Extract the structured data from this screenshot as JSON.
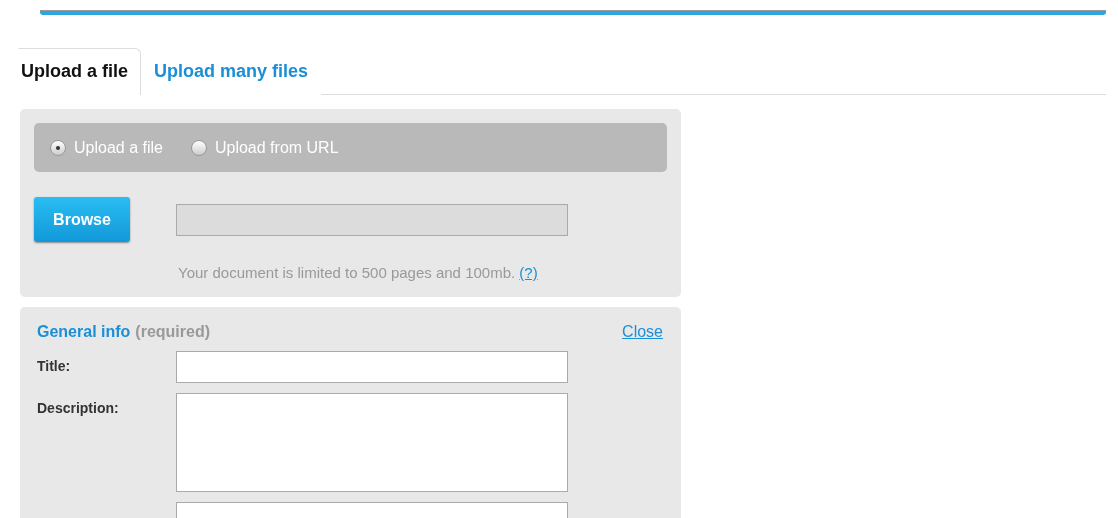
{
  "tabs": [
    {
      "label": "Upload a file",
      "selected": true
    },
    {
      "label": "Upload many files",
      "selected": false
    }
  ],
  "source_options": [
    {
      "label": "Upload a file",
      "selected": true
    },
    {
      "label": "Upload from URL",
      "selected": false
    }
  ],
  "browse_button": "Browse",
  "limit_note": {
    "text": "Your document is limited to 500 pages and 100mb.",
    "help_link": "(?)"
  },
  "general_info": {
    "title": "General info",
    "qualifier": "(required)",
    "close_link": "Close",
    "fields": [
      {
        "label": "Title:",
        "kind": "input"
      },
      {
        "label": "Description:",
        "kind": "textarea"
      },
      {
        "kind": "input"
      }
    ]
  }
}
